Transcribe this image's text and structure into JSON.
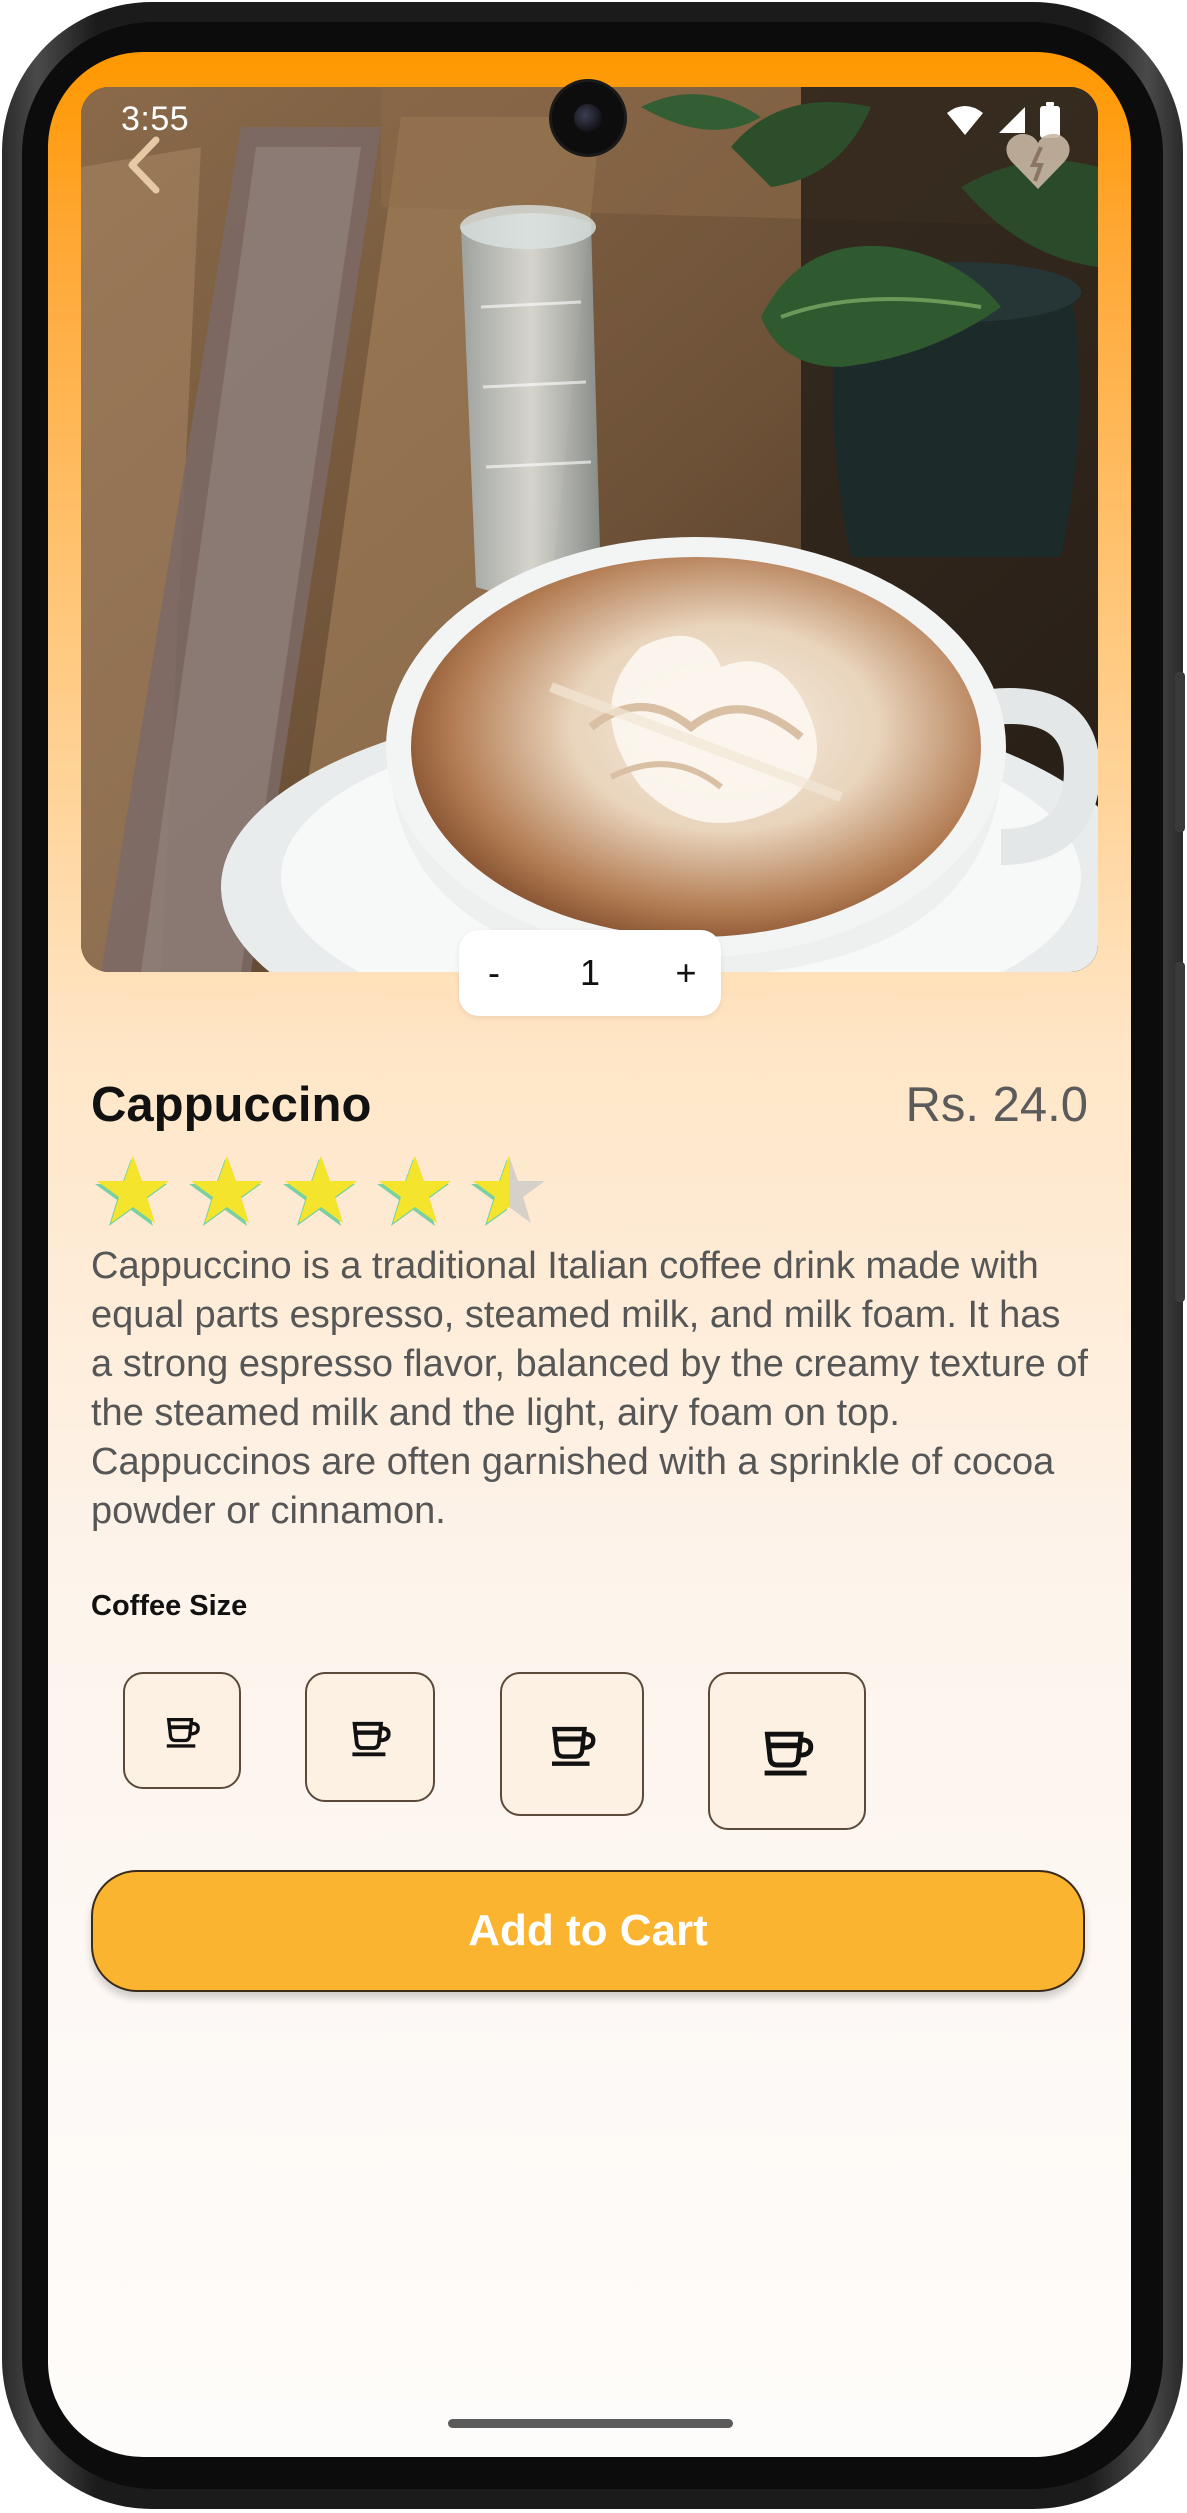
{
  "status_bar": {
    "time": "3:55",
    "icons": [
      "wifi-icon",
      "cellular-signal-icon",
      "battery-icon"
    ]
  },
  "header": {
    "back_icon": "chevron-left-icon",
    "favorite_icon": "heart-icon"
  },
  "hero": {
    "image": "cappuccino-photo"
  },
  "quantity": {
    "decrement_label": "-",
    "value": "1",
    "increment_label": "+"
  },
  "product": {
    "name": "Cappuccino",
    "price": "Rs. 24.0",
    "rating": 4.5,
    "rating_max": 5,
    "description": "Cappuccino is a traditional Italian coffee drink made with equal parts espresso, steamed milk, and milk foam. It has a strong espresso flavor, balanced by the creamy texture of the steamed milk and the light, airy foam on top. Cappuccinos are often garnished with a sprinkle of cocoa powder or cinnamon."
  },
  "sizes": {
    "label": "Coffee Size",
    "options": [
      "small",
      "medium",
      "large",
      "extra-large"
    ],
    "icon": "coffee-cup-icon"
  },
  "cart": {
    "button_label": "Add to Cart"
  },
  "colors": {
    "accent": "#fbb430",
    "header_orange": "#ff9800",
    "star": "#f4e42c"
  }
}
